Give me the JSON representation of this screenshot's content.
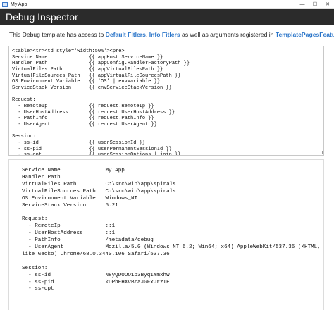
{
  "window": {
    "title": "My App",
    "minimize_glyph": "—",
    "maximize_glyph": "☐",
    "close_glyph": "✕"
  },
  "header": {
    "title": "Debug Inspector"
  },
  "intro": {
    "text_before": "This Debug template has access to ",
    "link_default_filters": "Default Fitlers",
    "sep1": ", ",
    "link_info_filters": "Info Fitlers",
    "text_middle": " as well as arguments registered in ",
    "link_feature": "TemplatePagesFeature",
    "text_end": "."
  },
  "editor": {
    "content": "<table><tr><td style='width:50%'><pre>\nService Name              {{ appHost.ServiceName }}\nHandler Path              {{ appConfig.HandlerFactoryPath }}\nVirtualFiles Path         {{ appVirtualFilesPath }}\nVirtualFileSources Path   {{ appVirtualFileSourcesPath }}\nOS Environment Variable   {{ 'OS' | envVariable }}\nServiceStack Version      {{ envServiceStackVersion }}\n\nRequest:\n  - RemoteIp              {{ request.RemoteIp }}\n  - UserHostAddress       {{ request.UserHostAddress }}\n  - PathInfo              {{ request.PathInfo }}\n  - UserAgent             {{ request.UserAgent }}\n\nSession:\n  - ss-id                 {{ userSessionId }}\n  - ss-pid                {{ userPermanentSessionId }}\n  - ss-opt                {{ userSessionOptions | join }}"
  },
  "output": {
    "content": "Service Name              My App\nHandler Path\nVirtualFiles Path         C:\\src\\wip\\app\\spirals\nVirtualFileSources Path   C:\\src\\wip\\app\\spirals\nOS Environment Variable   Windows_NT\nServiceStack Version      5.21\n\nRequest:\n  - RemoteIp              ::1\n  - UserHostAddress       ::1\n  - PathInfo              /metadata/debug\n  - UserAgent             Mozilla/5.0 (Windows NT 6.2; Win64; x64) AppleWebKit/537.36 (KHTML,\nlike Gecko) Chrome/68.0.3440.106 Safari/537.36\n\nSession:\n  - ss-id                 N8yQDOOO1p3Byq1YmxhW\n  - ss-pid                kDPhEHXvBraJGFxJrzTE\n  - ss-opt"
  }
}
